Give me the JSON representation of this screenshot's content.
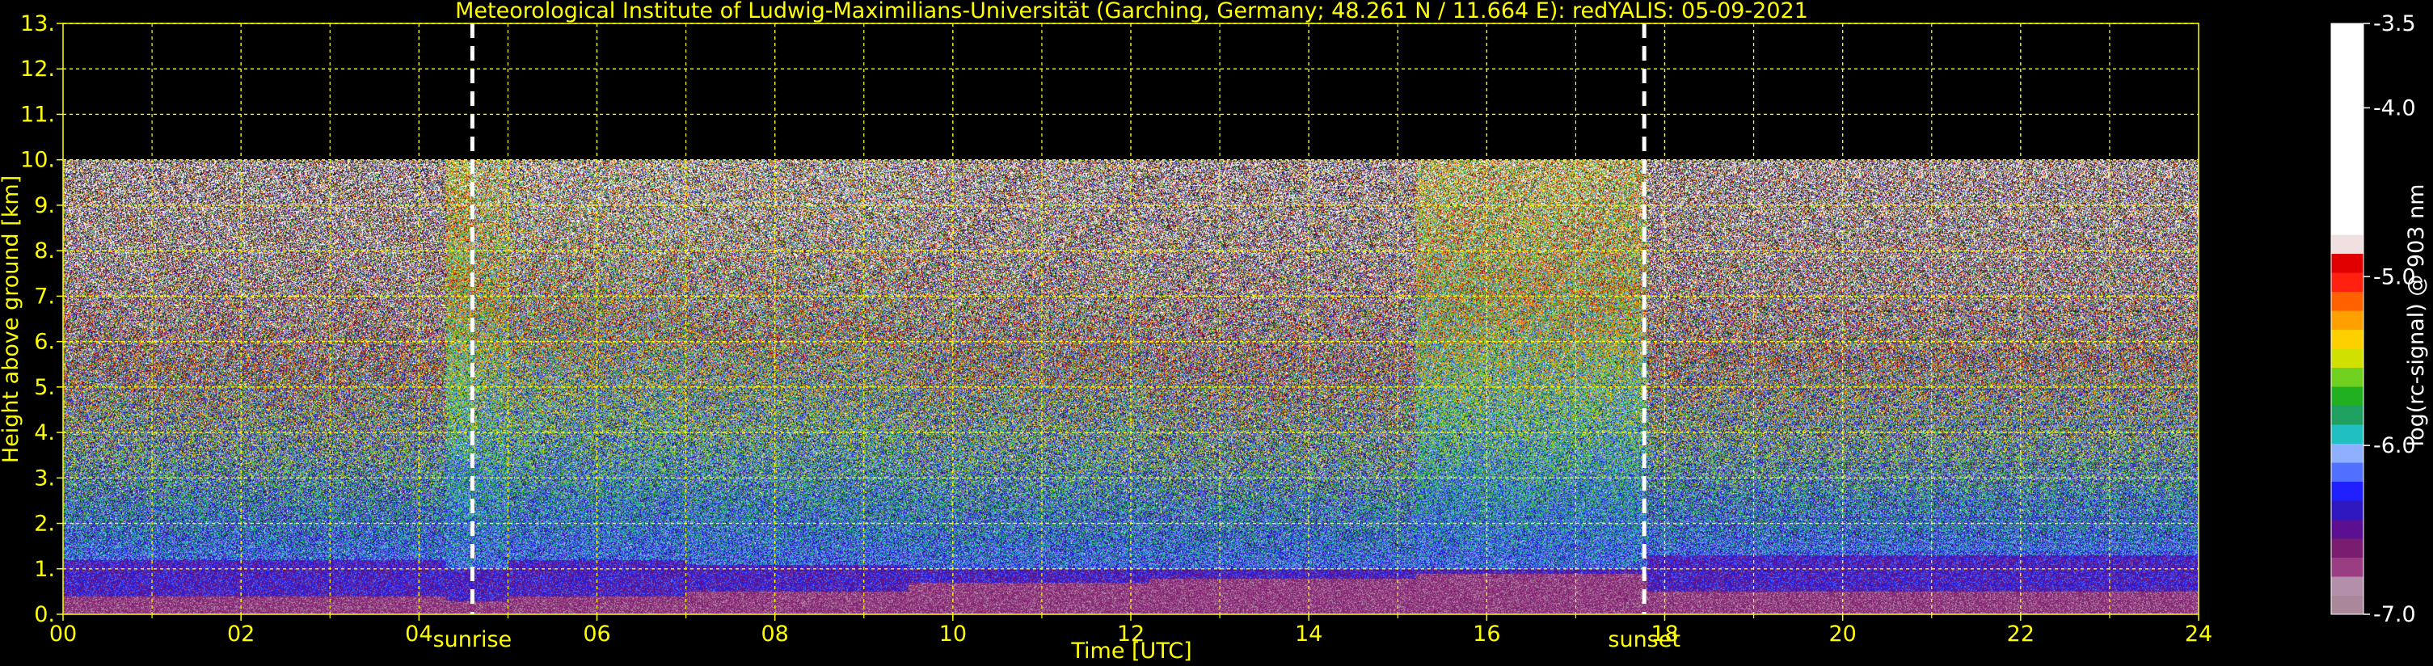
{
  "chart_data": [
    {
      "type": "heatmap",
      "title": "Meteorological Institute of Ludwig-Maximilians-Universität (Garching, Germany; 48.261 N / 11.664 E):    redYALIS: 05-09-2021",
      "xlabel": "Time [UTC]",
      "ylabel": "Height above ground [km]",
      "xlim": [
        0,
        24
      ],
      "ylim": [
        0,
        13
      ],
      "x_ticks": [
        "00",
        "02",
        "04",
        "06",
        "08",
        "10",
        "12",
        "14",
        "16",
        "18",
        "20",
        "22",
        "24"
      ],
      "y_ticks": [
        "0.",
        "1.",
        "2.",
        "3.",
        "4.",
        "5.",
        "6.",
        "7.",
        "8.",
        "9.",
        "10.",
        "11.",
        "12.",
        "13."
      ],
      "x_minor_gridlines": [
        1,
        3,
        5,
        7,
        9,
        11,
        13,
        15,
        17,
        19,
        21,
        23
      ],
      "grid": true,
      "data_top_km": 10,
      "events": [
        {
          "label": "sunrise",
          "time": 4.6
        },
        {
          "label": "sunset",
          "time": 17.77
        }
      ],
      "colorbar": {
        "label": "log(rc-signal) @ 903 nm",
        "range": [
          -7.0,
          -3.5
        ],
        "ticks": [
          "-3.5",
          "-4.0",
          "-5.0",
          "-6.0",
          "-7.0"
        ]
      },
      "colors": {
        "background": "#000000",
        "text": "#ffff00",
        "grid": "#ffff00",
        "event_line": "#ffffff",
        "colorbar_text": "#ffffff",
        "colorscale": [
          "#aa8899",
          "#b48fa9",
          "#9a3d82",
          "#7a1d70",
          "#5a1090",
          "#3018c0",
          "#2020ff",
          "#5070ff",
          "#8fb0ff",
          "#20c0c0",
          "#20a060",
          "#20b020",
          "#70d020",
          "#d0e000",
          "#ffd000",
          "#ffa000",
          "#ff6000",
          "#ff2010",
          "#e00000",
          "#f0e0e0",
          "#ffffff"
        ]
      },
      "segments": [
        {
          "time": [
            0.0,
            4.3
          ],
          "boundary_layer_km": 1.2,
          "aerosol_km": 0.4,
          "top_noise": 0.85
        },
        {
          "time": [
            4.3,
            4.6
          ],
          "boundary_layer_km": 1.0,
          "aerosol_km": 0.3,
          "top_noise": 0.3
        },
        {
          "time": [
            4.6,
            5.0
          ],
          "boundary_layer_km": 1.0,
          "aerosol_km": 0.3,
          "top_noise": 0.4
        },
        {
          "time": [
            5.0,
            7.0
          ],
          "boundary_layer_km": 1.2,
          "aerosol_km": 0.4,
          "top_noise": 0.55
        },
        {
          "time": [
            7.0,
            9.5
          ],
          "boundary_layer_km": 1.1,
          "aerosol_km": 0.5,
          "top_noise": 0.6
        },
        {
          "time": [
            9.5,
            12.2
          ],
          "boundary_layer_km": 1.0,
          "aerosol_km": 0.7,
          "top_noise": 0.7
        },
        {
          "time": [
            12.2,
            15.2
          ],
          "boundary_layer_km": 1.0,
          "aerosol_km": 0.8,
          "top_noise": 0.8
        },
        {
          "time": [
            15.2,
            17.8
          ],
          "boundary_layer_km": 1.0,
          "aerosol_km": 0.9,
          "top_noise": 0.35
        },
        {
          "time": [
            17.8,
            24.0
          ],
          "boundary_layer_km": 1.3,
          "aerosol_km": 0.5,
          "top_noise": 0.8
        }
      ]
    }
  ]
}
